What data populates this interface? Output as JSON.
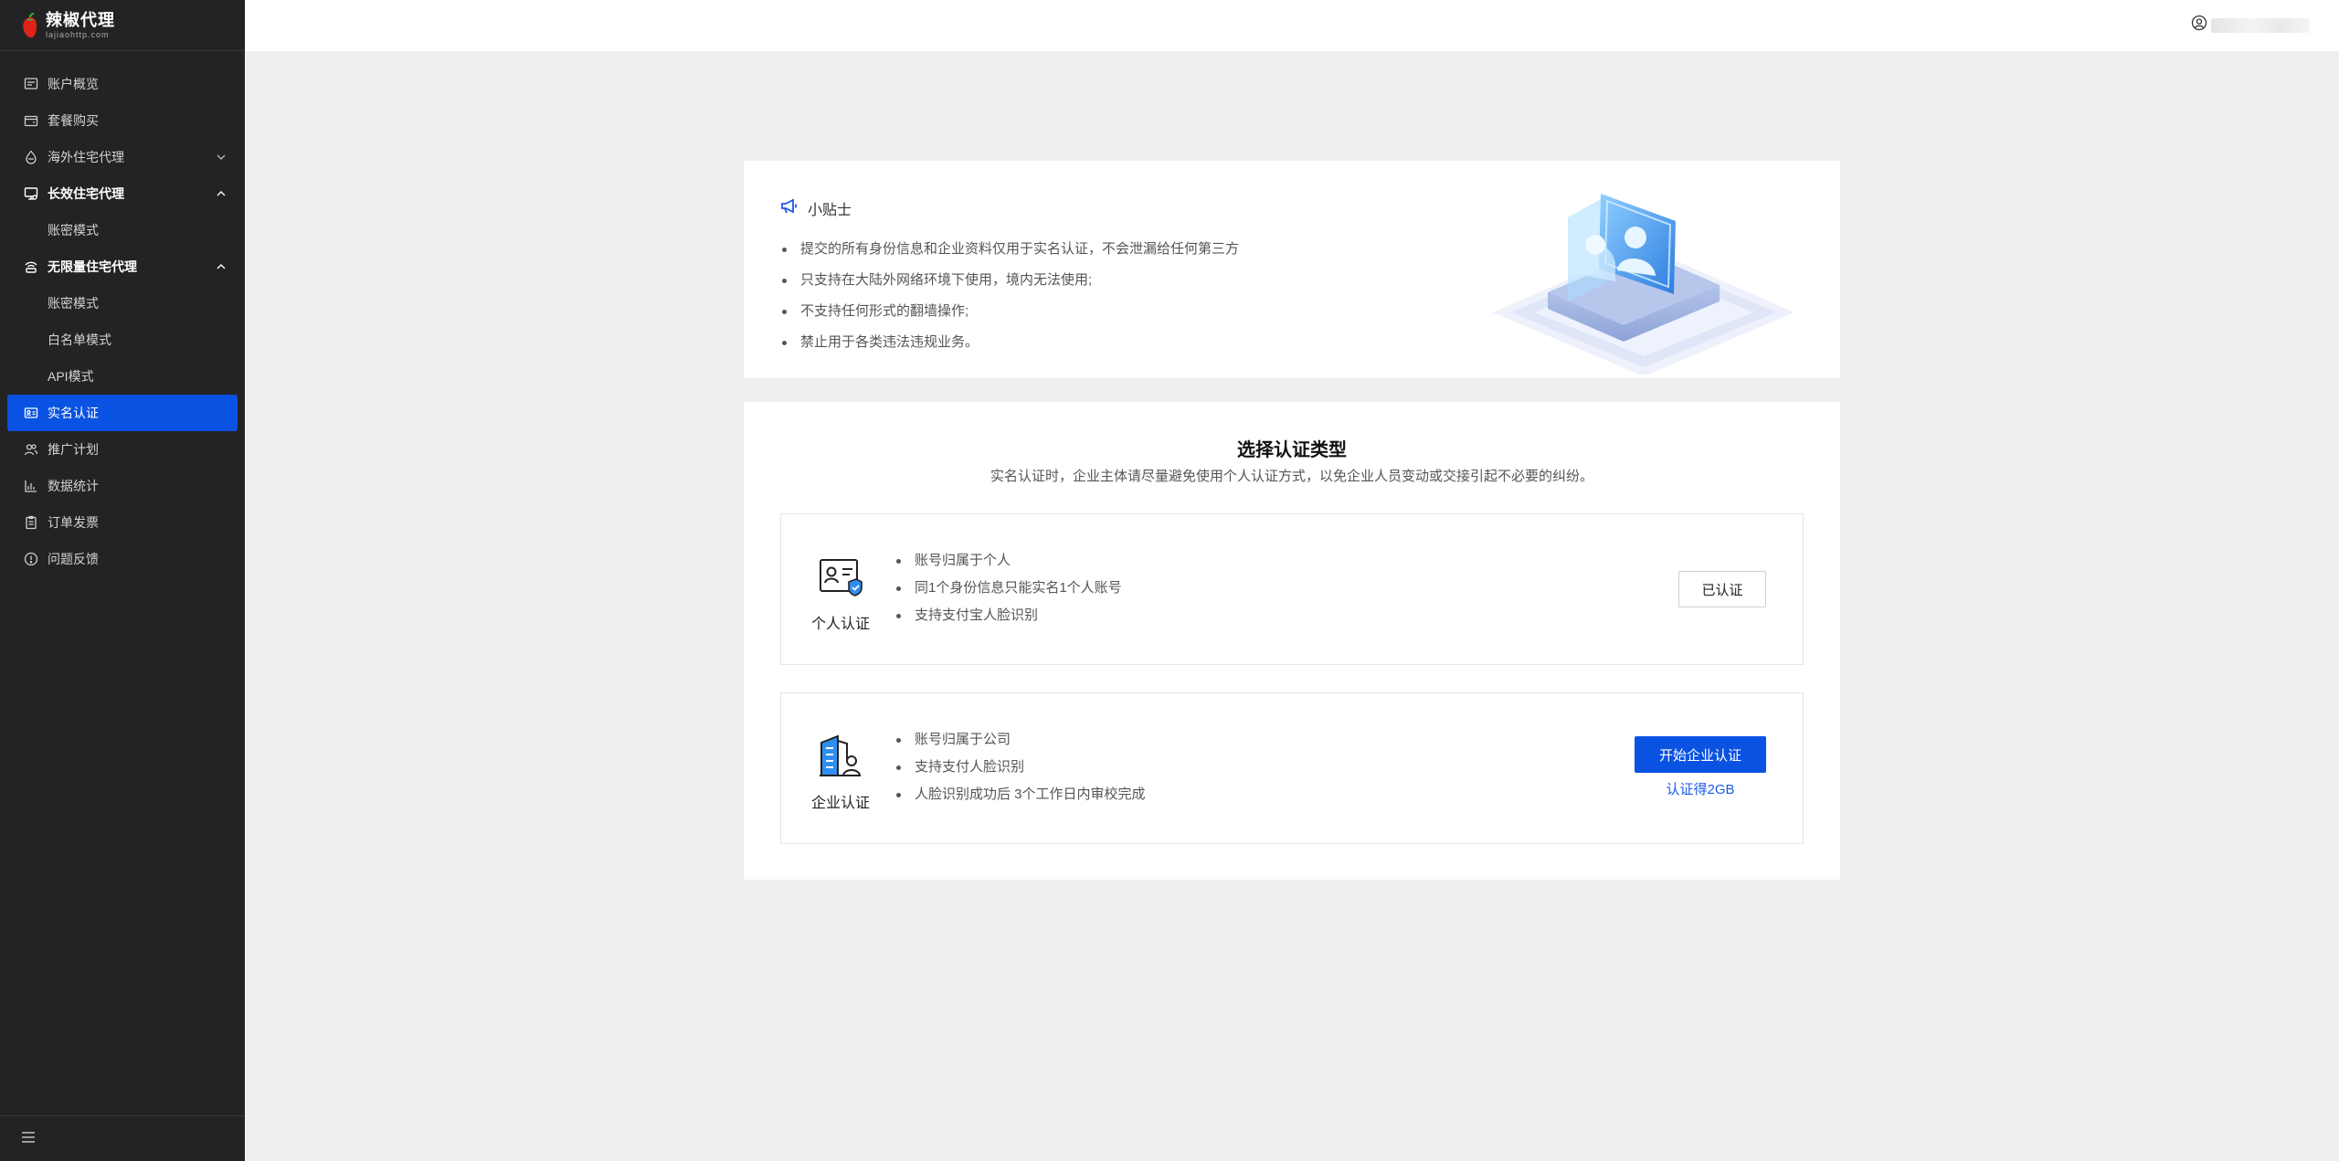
{
  "brand": {
    "name": "辣椒代理",
    "url": "lajiaohttp.com"
  },
  "sidebar": {
    "items": [
      {
        "label": "账户概览",
        "icon": "dashboard-icon"
      },
      {
        "label": "套餐购买",
        "icon": "wallet-icon"
      },
      {
        "label": "海外住宅代理",
        "icon": "drop-icon",
        "expanded": false
      },
      {
        "label": "长效住宅代理",
        "icon": "monitor-icon",
        "expanded": true
      },
      {
        "label": "账密模式",
        "sub": true
      },
      {
        "label": "无限量住宅代理",
        "icon": "router-icon",
        "expanded": true
      },
      {
        "label": "账密模式",
        "sub": true
      },
      {
        "label": "白名单模式",
        "sub": true
      },
      {
        "label": "API模式",
        "sub": true
      },
      {
        "label": "实名认证",
        "icon": "id-card-icon",
        "active": true
      },
      {
        "label": "推广计划",
        "icon": "users-icon"
      },
      {
        "label": "数据统计",
        "icon": "chart-icon"
      },
      {
        "label": "订单发票",
        "icon": "clipboard-icon"
      },
      {
        "label": "问题反馈",
        "icon": "alert-icon"
      }
    ]
  },
  "tips": {
    "title": "小贴士",
    "items": [
      "提交的所有身份信息和企业资料仅用于实名认证，不会泄漏给任何第三方",
      "只支持在大陆外网络环境下使用，境内无法使用;",
      "不支持任何形式的翻墙操作;",
      "禁止用于各类违法违规业务。"
    ]
  },
  "verify": {
    "title": "选择认证类型",
    "subtitle": "实名认证时，企业主体请尽量避免使用个人认证方式，以免企业人员变动或交接引起不必要的纠纷。",
    "personal": {
      "label": "个人认证",
      "features": [
        "账号归属于个人",
        "同1个身份信息只能实名1个人账号",
        "支持支付宝人脸识别"
      ],
      "button": "已认证"
    },
    "enterprise": {
      "label": "企业认证",
      "features": [
        "账号归属于公司",
        "支持支付人脸识别",
        "人脸识别成功后 3个工作日内审校完成"
      ],
      "button": "开始企业认证",
      "reward": "认证得2GB"
    }
  },
  "colors": {
    "accent": "#0a52e1",
    "sidebar_bg": "#232325",
    "page_bg": "#efefef"
  }
}
